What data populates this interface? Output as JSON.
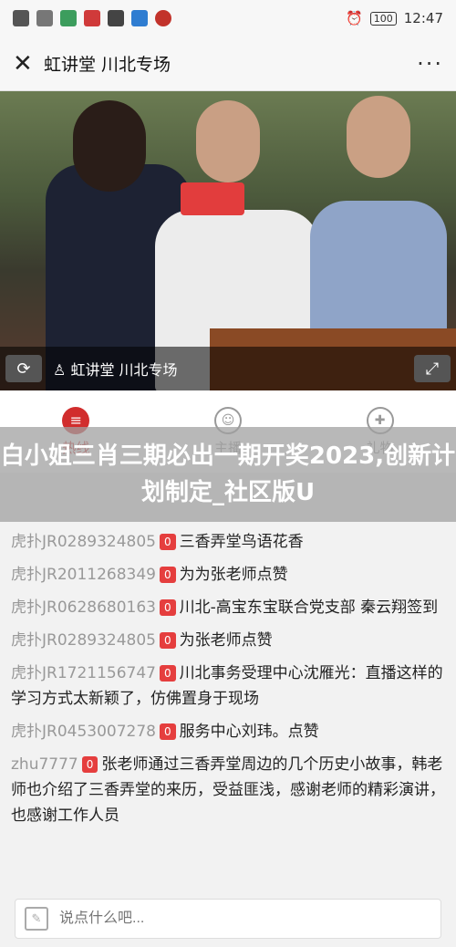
{
  "status_bar": {
    "time": "12:47",
    "battery": "100",
    "icons_left": [
      "carrier-icon",
      "wifi-icon",
      "image-icon",
      "mail-icon",
      "app-icon",
      "send-icon",
      "notification-icon"
    ]
  },
  "app_bar": {
    "title": "虹讲堂 川北专场",
    "more_label": "···",
    "close_label": "✕"
  },
  "video": {
    "title": "虹讲堂 川北专场",
    "refresh_label": "⟳",
    "fullscreen_label": "⤢"
  },
  "tabs": [
    {
      "label": "热线",
      "active": true
    },
    {
      "label": "主播",
      "active": false
    },
    {
      "label": "礼物",
      "active": false
    }
  ],
  "overlay": {
    "text": "白小姐三肖三期必出一期开奖2023,创新计划制定_社区版U"
  },
  "comments": [
    {
      "user": "虎扑JR0289324805",
      "badge": "0",
      "text": "三香弄堂鸟语花香"
    },
    {
      "user": "虎扑JR2011268349",
      "badge": "0",
      "text": "为为张老师点赞"
    },
    {
      "user": "虎扑JR0628680163",
      "badge": "0",
      "text": "川北-高宝东宝联合党支部 秦云翔签到"
    },
    {
      "user": "虎扑JR0289324805",
      "badge": "0",
      "text": "为张老师点赞"
    },
    {
      "user": "虎扑JR1721156747",
      "badge": "0",
      "text": "川北事务受理中心沈雁光：直播这样的学习方式太新颖了，仿佛置身于现场"
    },
    {
      "user": "虎扑JR0453007278",
      "badge": "0",
      "text": "服务中心刘玮。点赞"
    },
    {
      "user": "zhu7777",
      "badge": "0",
      "text": "张老师通过三香弄堂周边的几个历史小故事，韩老师也介绍了三香弄堂的来历，受益匪浅，感谢老师的精彩演讲，也感谢工作人员"
    }
  ],
  "input": {
    "placeholder": "说点什么吧..."
  },
  "colors": {
    "accent": "#d12d2d",
    "badge": "#e53e3e"
  }
}
